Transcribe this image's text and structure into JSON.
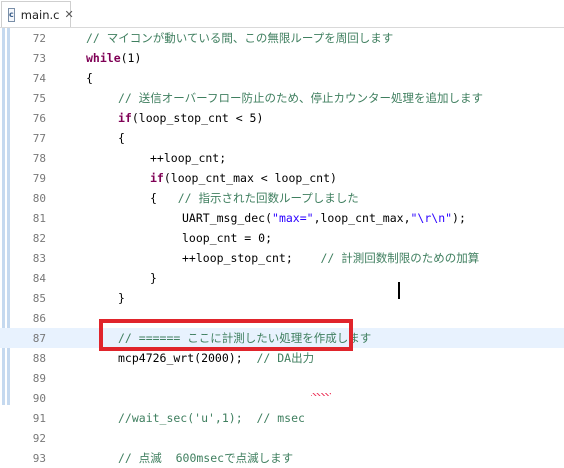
{
  "tab": {
    "icon_letter": "c",
    "label": "main.c",
    "close": "✕"
  },
  "lines": [
    {
      "num": "72",
      "indent": 0,
      "parts": [
        {
          "t": "// マイコンが動いている間、この無限ループを周回します",
          "c": "cm"
        }
      ]
    },
    {
      "num": "73",
      "indent": 0,
      "parts": [
        {
          "t": "while",
          "c": "kw"
        },
        {
          "t": "(1)",
          "c": ""
        }
      ]
    },
    {
      "num": "74",
      "indent": 0,
      "parts": [
        {
          "t": "{",
          "c": ""
        }
      ]
    },
    {
      "num": "75",
      "indent": 1,
      "parts": [
        {
          "t": "// 送信オーバーフロー防止のため、停止カウンター処理を追加します",
          "c": "cm"
        }
      ]
    },
    {
      "num": "76",
      "indent": 1,
      "parts": [
        {
          "t": "if",
          "c": "kw"
        },
        {
          "t": "(loop_stop_cnt < 5)",
          "c": ""
        }
      ]
    },
    {
      "num": "77",
      "indent": 1,
      "parts": [
        {
          "t": "{",
          "c": ""
        }
      ]
    },
    {
      "num": "78",
      "indent": 2,
      "parts": [
        {
          "t": "++loop_cnt;",
          "c": ""
        }
      ]
    },
    {
      "num": "79",
      "indent": 2,
      "parts": [
        {
          "t": "if",
          "c": "kw"
        },
        {
          "t": "(loop_cnt_max < loop_cnt)",
          "c": ""
        }
      ]
    },
    {
      "num": "80",
      "indent": 2,
      "parts": [
        {
          "t": "{   ",
          "c": ""
        },
        {
          "t": "// 指示された回数ループしました",
          "c": "cm"
        }
      ]
    },
    {
      "num": "81",
      "indent": 3,
      "parts": [
        {
          "t": "UART_msg_dec(",
          "c": ""
        },
        {
          "t": "\"max=\"",
          "c": "str"
        },
        {
          "t": ",loop_cnt_max,",
          "c": ""
        },
        {
          "t": "\"\\r\\n\"",
          "c": "str"
        },
        {
          "t": ");",
          "c": ""
        }
      ]
    },
    {
      "num": "82",
      "indent": 3,
      "parts": [
        {
          "t": "loop_cnt = 0;",
          "c": ""
        }
      ]
    },
    {
      "num": "83",
      "indent": 3,
      "parts": [
        {
          "t": "++loop_stop_cnt;    ",
          "c": ""
        },
        {
          "t": "// 計測回数制限のための加算",
          "c": "cm"
        }
      ]
    },
    {
      "num": "84",
      "indent": 2,
      "parts": [
        {
          "t": "}",
          "c": ""
        }
      ]
    },
    {
      "num": "85",
      "indent": 1,
      "parts": [
        {
          "t": "}",
          "c": ""
        }
      ]
    },
    {
      "num": "86",
      "indent": 0,
      "parts": []
    },
    {
      "num": "87",
      "indent": 1,
      "parts": [
        {
          "t": "// ====== ここに計測したい処理を作成します",
          "c": "cm"
        }
      ],
      "current": true
    },
    {
      "num": "88",
      "indent": 1,
      "parts": [
        {
          "t": "mcp4726_wrt(2000);  ",
          "c": ""
        },
        {
          "t": "// DA出力",
          "c": "cm"
        }
      ]
    },
    {
      "num": "89",
      "indent": 0,
      "parts": []
    },
    {
      "num": "90",
      "indent": 0,
      "parts": []
    },
    {
      "num": "91",
      "indent": 1,
      "parts": [
        {
          "t": "//wait_sec('u',1);  // msec",
          "c": "cm"
        }
      ]
    },
    {
      "num": "92",
      "indent": 0,
      "parts": []
    },
    {
      "num": "93",
      "indent": 1,
      "parts": [
        {
          "t": "// 点滅  600msecで点滅します",
          "c": "cm"
        }
      ]
    }
  ],
  "colors": {
    "keyword": "#7f0055",
    "comment": "#3f7f5f",
    "string": "#2a00ff",
    "highlight_box": "#e0242b"
  }
}
